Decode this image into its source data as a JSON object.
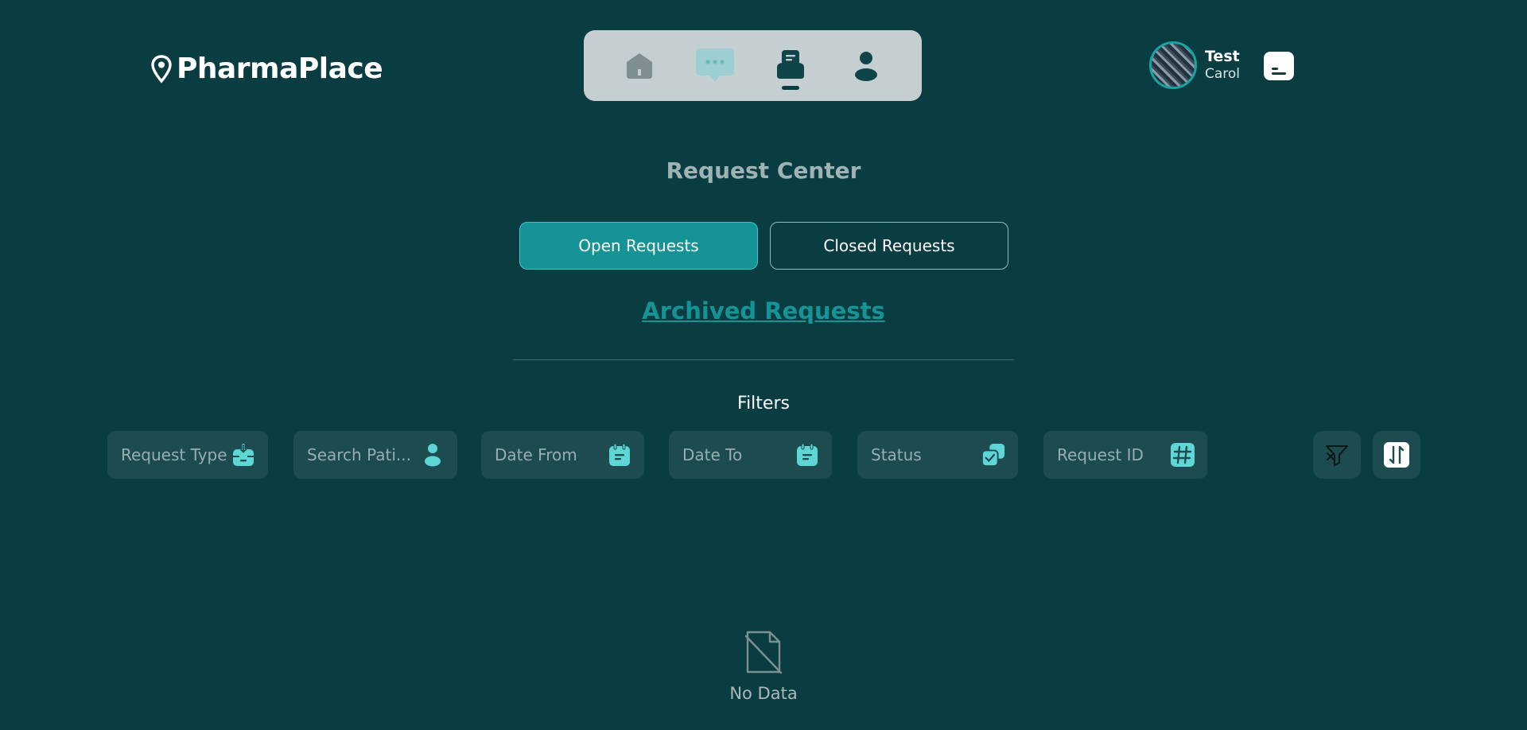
{
  "brand": {
    "name": "PharmaPlace",
    "icon": "location-pin-icon"
  },
  "nav": {
    "items": [
      {
        "name": "home",
        "icon": "home-icon",
        "active": false
      },
      {
        "name": "messages",
        "icon": "chat-bubble-icon",
        "active": false
      },
      {
        "name": "requests",
        "icon": "request-badge-icon",
        "active": true
      },
      {
        "name": "profile",
        "icon": "person-icon",
        "active": false
      }
    ]
  },
  "user": {
    "first_name": "Test",
    "last_name": "Carol"
  },
  "page": {
    "title": "Request Center",
    "tabs": {
      "open": "Open Requests",
      "closed": "Closed Requests"
    },
    "archived_link": "Archived Requests",
    "filters_label": "Filters"
  },
  "filters": [
    {
      "placeholder": "Request Type",
      "icon": "inbox-tray-icon"
    },
    {
      "placeholder": "Search Pati...",
      "icon": "person-icon"
    },
    {
      "placeholder": "Date From",
      "icon": "calendar-icon"
    },
    {
      "placeholder": "Date To",
      "icon": "calendar-icon"
    },
    {
      "placeholder": "Status",
      "icon": "status-check-icon"
    },
    {
      "placeholder": "Request ID",
      "icon": "hash-icon"
    }
  ],
  "actions": {
    "clear_filter_icon": "filter-clear-icon",
    "sort_icon": "sort-icon"
  },
  "empty_state": {
    "text": "No Data",
    "icon": "empty-document-icon"
  },
  "colors": {
    "background": "#0a3d42",
    "accent": "#159395",
    "icon_accent": "#5fd6d6",
    "nav_pill": "#c5cfd1"
  }
}
